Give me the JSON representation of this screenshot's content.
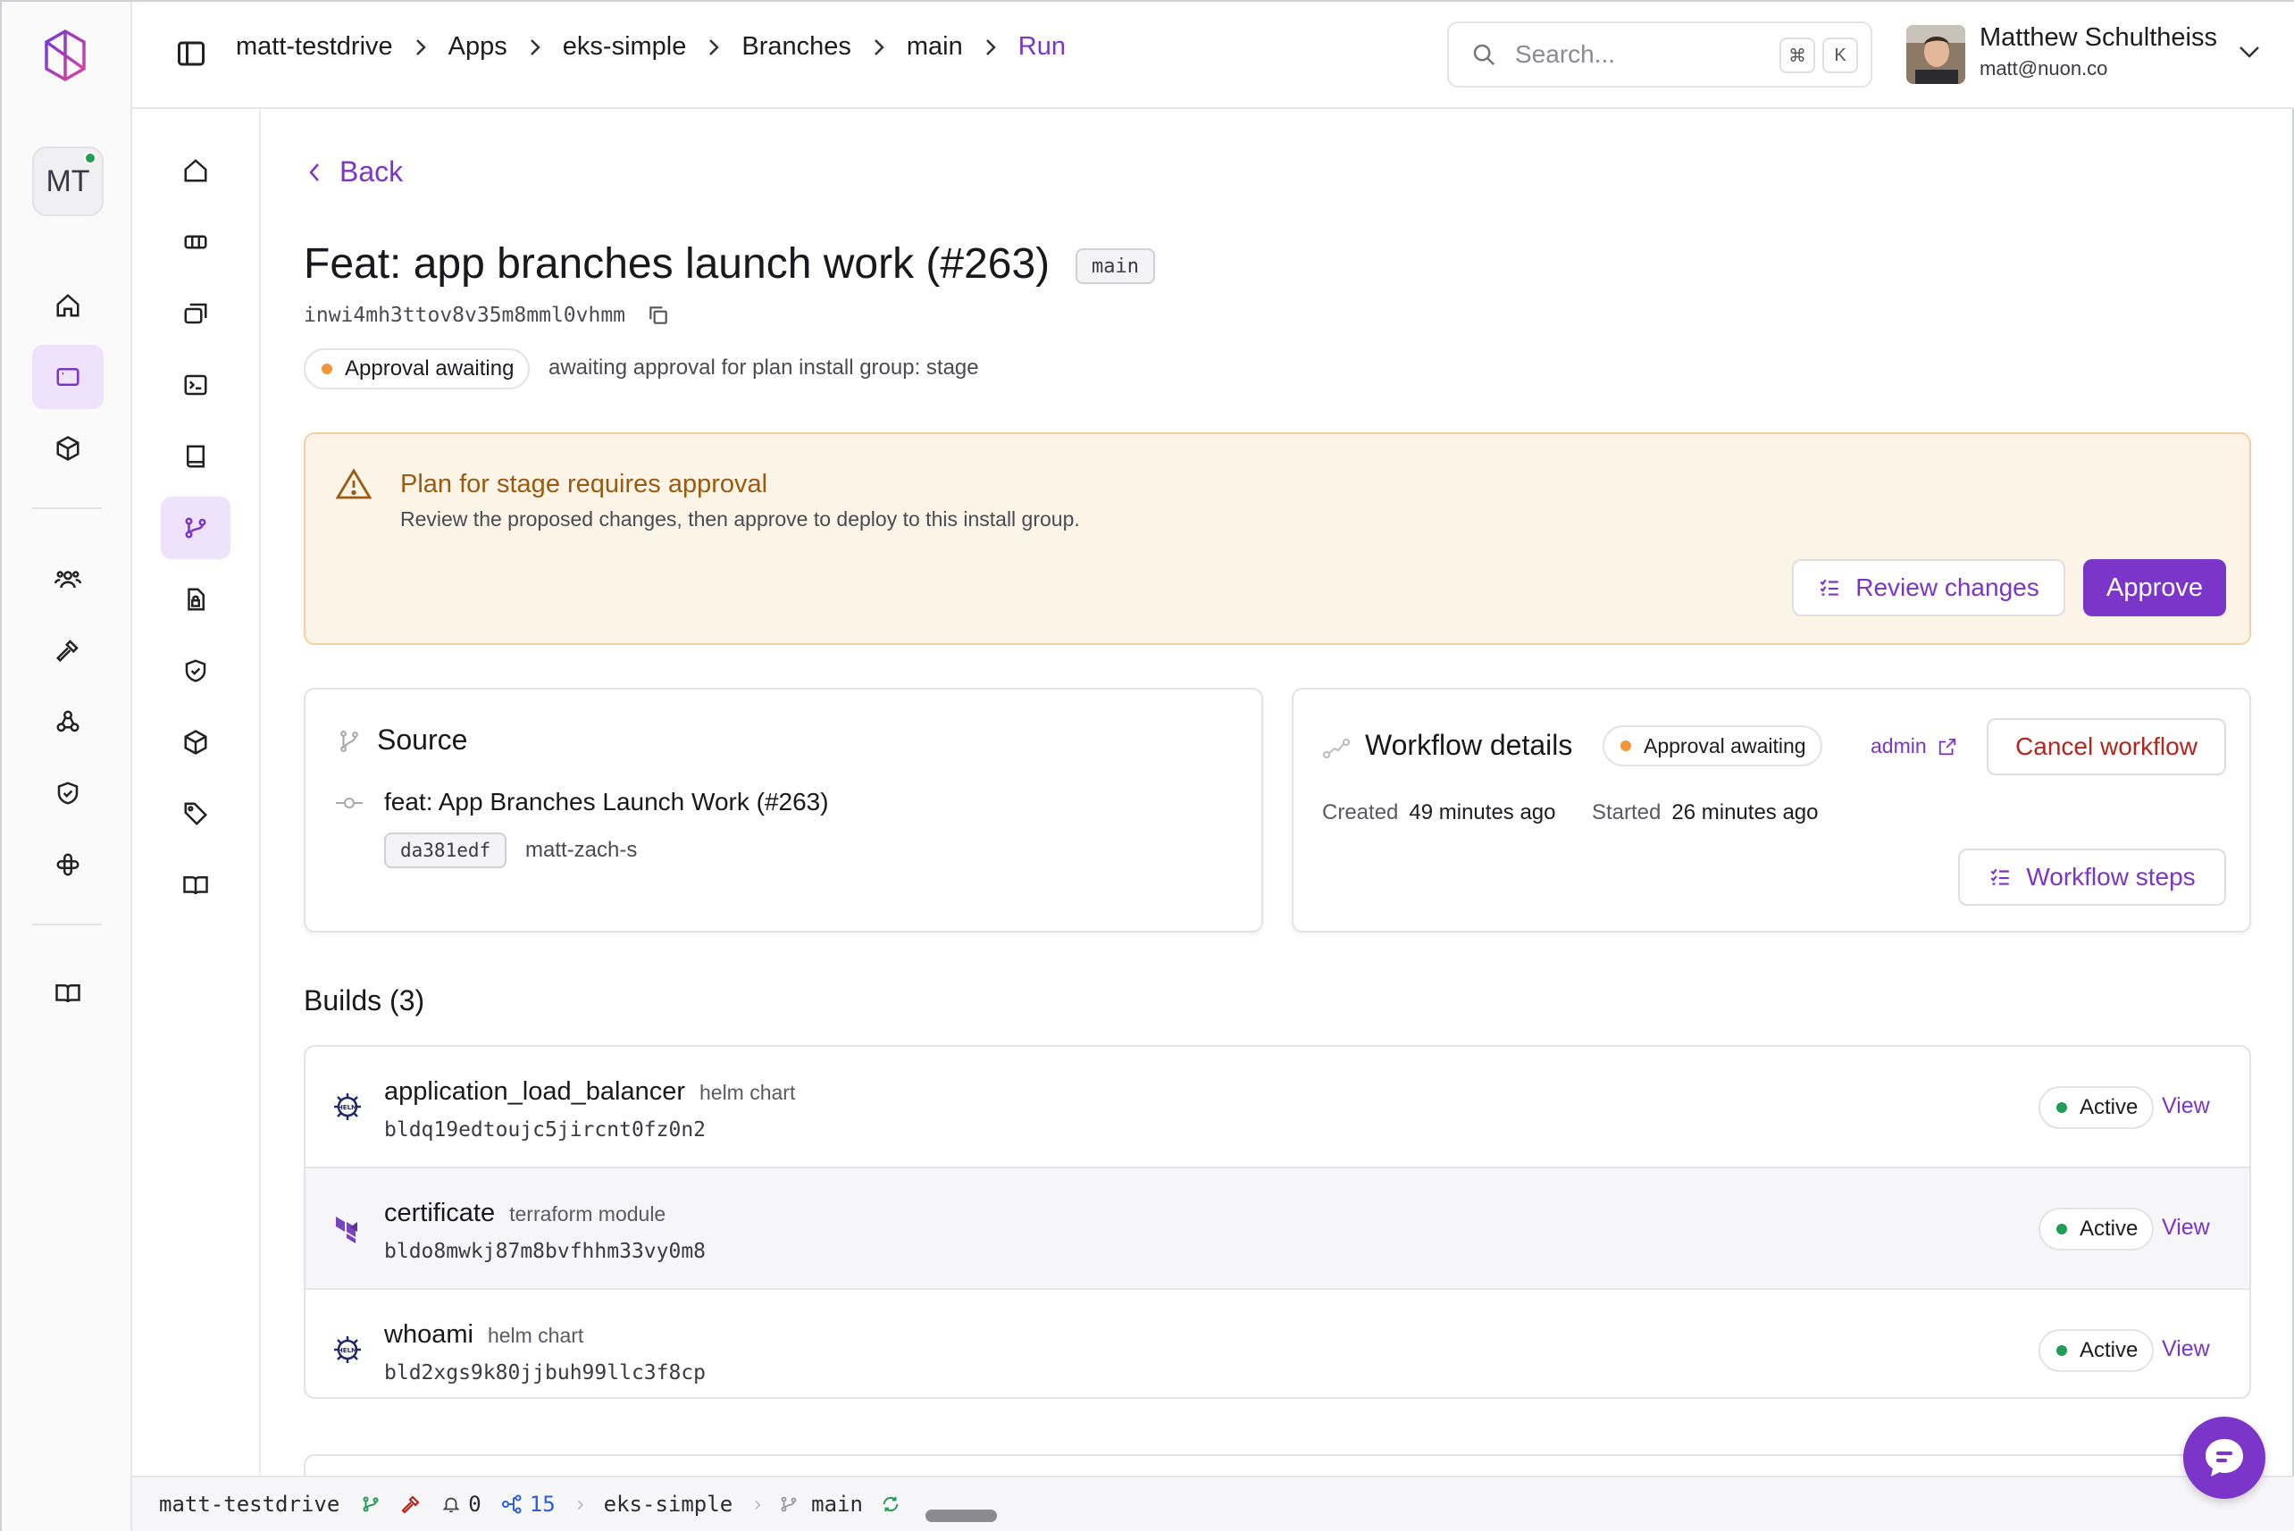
{
  "topbar": {
    "breadcrumbs": [
      "matt-testdrive",
      "Apps",
      "eks-simple",
      "Branches",
      "main",
      "Run"
    ],
    "search_placeholder": "Search...",
    "shortcut_keys": [
      "⌘",
      "K"
    ],
    "user": {
      "name": "Matthew Schultheiss",
      "email": "matt@nuon.co"
    }
  },
  "rail": {
    "org_initials": "MT"
  },
  "page": {
    "back_label": "Back",
    "title": "Feat: app branches launch work (#263)",
    "branch": "main",
    "run_id": "inwi4mh3ttov8v35m8mml0vhmm",
    "status": "Approval awaiting",
    "status_desc": "awaiting approval for plan install group: stage"
  },
  "approval": {
    "title": "Plan for stage requires approval",
    "description": "Review the proposed changes, then approve to deploy to this install group.",
    "review_label": "Review changes",
    "approve_label": "Approve"
  },
  "source": {
    "title": "Source",
    "commit_message": "feat: App Branches Launch Work (#263)",
    "commit_sha": "da381edf",
    "author": "matt-zach-s"
  },
  "workflow": {
    "title": "Workflow details",
    "status": "Approval awaiting",
    "admin_label": "admin",
    "cancel_label": "Cancel workflow",
    "created_label": "Created",
    "created_value": "49 minutes ago",
    "started_label": "Started",
    "started_value": "26 minutes ago",
    "steps_label": "Workflow steps"
  },
  "builds": {
    "title": "Builds (3)",
    "items": [
      {
        "name": "application_load_balancer",
        "type": "helm chart",
        "id": "bldq19edtoujc5jircnt0fz0n2",
        "status": "Active",
        "view": "View",
        "icon": "helm-icon"
      },
      {
        "name": "certificate",
        "type": "terraform module",
        "id": "bldo8mwkj87m8bvfhhm33vy0m8",
        "status": "Active",
        "view": "View",
        "icon": "terraform-icon"
      },
      {
        "name": "whoami",
        "type": "helm chart",
        "id": "bld2xgs9k80jjbuh99llc3f8cp",
        "status": "Active",
        "view": "View",
        "icon": "helm-icon"
      }
    ]
  },
  "statusbar": {
    "org": "matt-testdrive",
    "notifications": "0",
    "count": "15",
    "app": "eks-simple",
    "branch": "main"
  },
  "colors": {
    "accent": "#7b35c8",
    "warning_bg": "#fdf4e8",
    "active": "#1f9d55",
    "awaiting": "#f0953a",
    "danger": "#b3261e"
  }
}
